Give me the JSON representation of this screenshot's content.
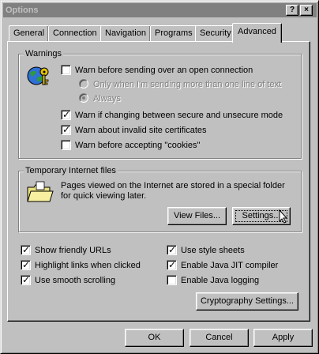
{
  "window": {
    "title": "Options",
    "help_button": "?",
    "close_button": "×"
  },
  "tabs": [
    {
      "label": "General",
      "active": false
    },
    {
      "label": "Connection",
      "active": false
    },
    {
      "label": "Navigation",
      "active": false
    },
    {
      "label": "Programs",
      "active": false
    },
    {
      "label": "Security",
      "active": false
    },
    {
      "label": "Advanced",
      "active": true
    }
  ],
  "warnings": {
    "group_label": "Warnings",
    "icon": "globe-key-icon",
    "items": [
      {
        "label": "Warn before sending over an open connection",
        "checked": false
      },
      {
        "label": "Warn if changing between secure and unsecure mode",
        "checked": true
      },
      {
        "label": "Warn about invalid site certificates",
        "checked": true
      },
      {
        "label": "Warn before accepting \"cookies\"",
        "checked": false
      }
    ],
    "radios": [
      {
        "label": "Only when I'm sending more than one line of text",
        "selected": false,
        "disabled": true
      },
      {
        "label": "Always",
        "selected": true,
        "disabled": true
      }
    ]
  },
  "temp_files": {
    "group_label": "Temporary Internet files",
    "icon": "folder-icon",
    "description": "Pages viewed on the Internet are stored in a special folder for quick viewing later.",
    "view_files_label": "View Files...",
    "settings_label": "Settings..."
  },
  "options": {
    "left": [
      {
        "label": "Show friendly URLs",
        "checked": true
      },
      {
        "label": "Highlight links when clicked",
        "checked": true
      },
      {
        "label": "Use smooth scrolling",
        "checked": true
      }
    ],
    "right": [
      {
        "label": "Use style sheets",
        "checked": true
      },
      {
        "label": "Enable Java JIT compiler",
        "checked": true
      },
      {
        "label": "Enable Java logging",
        "checked": false
      }
    ],
    "cryptography_label": "Cryptography Settings..."
  },
  "footer": {
    "ok_label": "OK",
    "cancel_label": "Cancel",
    "apply_label": "Apply"
  }
}
